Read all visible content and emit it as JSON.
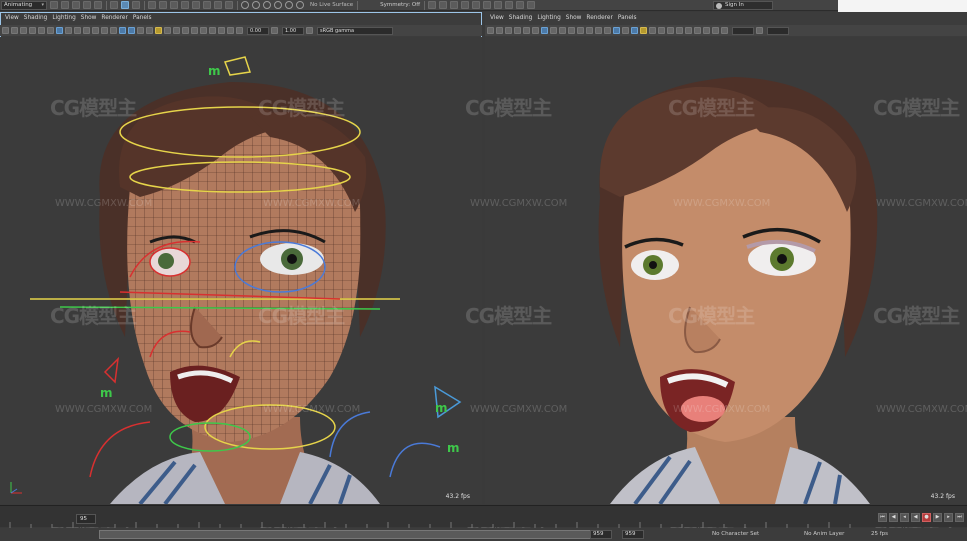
{
  "statusline": {
    "mode": "Animating",
    "live_surface": "No Live Surface",
    "symmetry": "Symmetry: Off",
    "signin": "Sign In"
  },
  "left_panel": {
    "menu": [
      "View",
      "Shading",
      "Lighting",
      "Show",
      "Renderer",
      "Panels"
    ],
    "near_clip": "0.00",
    "exposure": "1.00",
    "color_space": "sRGB gamma",
    "fps": "43.2 fps"
  },
  "right_panel": {
    "menu": [
      "View",
      "Shading",
      "Lighting",
      "Show",
      "Renderer",
      "Panels"
    ],
    "fps": "43.2 fps"
  },
  "timeslider": {
    "current_frame": "95"
  },
  "rangeslider": {
    "start_frame": "959",
    "end_frame": "959",
    "character_set": "No Character Set",
    "anim_layer": "No Anim Layer",
    "fps": "25 fps"
  },
  "watermarks": {
    "brand": "CG模型主",
    "url": "WWW.CGMXW.COM"
  },
  "colors": {
    "viewport_bg": "#3b3b3b",
    "active_border": "#9cc5e8",
    "record_red": "#b53c3c"
  }
}
